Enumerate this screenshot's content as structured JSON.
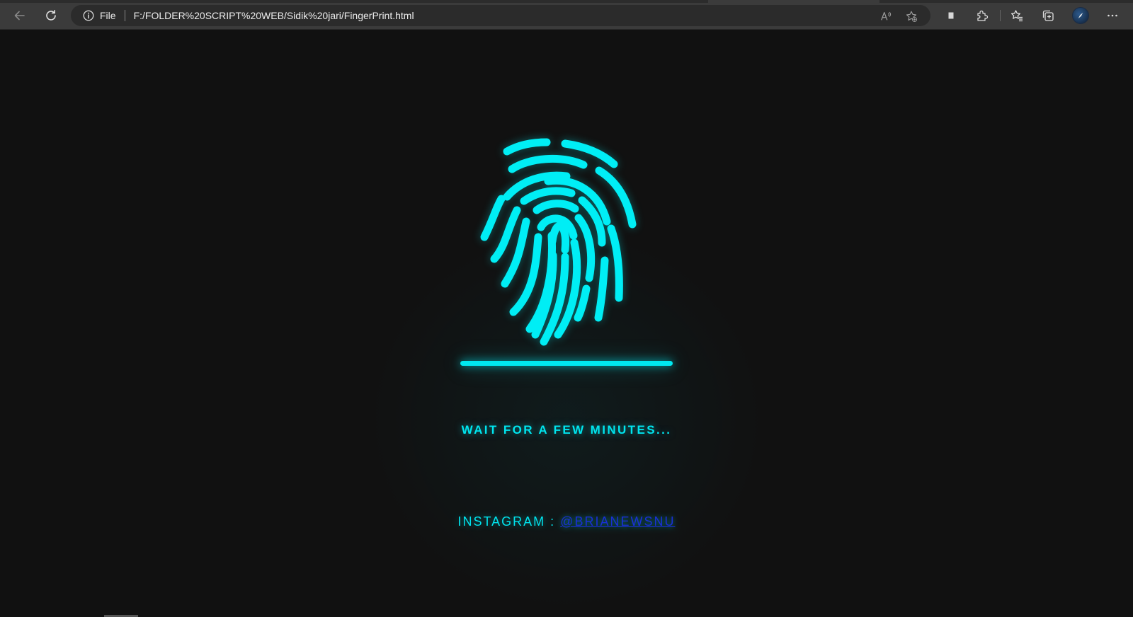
{
  "browser": {
    "site_info_label": "File",
    "url": "F:/FOLDER%20SCRIPT%20WEB/Sidik%20jari/FingerPrint.html",
    "icons": {
      "back": "back-arrow-icon",
      "reload": "reload-icon",
      "site_info": "info-icon",
      "read_aloud": "read-aloud-icon",
      "add_favorite": "add-favorite-icon",
      "stop": "stop-icon",
      "extensions": "extensions-icon",
      "favorites": "favorites-icon",
      "collections": "collections-icon",
      "profile": "profile-avatar",
      "menu": "more-menu-icon"
    }
  },
  "page": {
    "status_text": "WAIT FOR A FEW MINUTES...",
    "instagram_label": "INSTAGRAM : ",
    "instagram_handle": "@BRIANEWSNU",
    "accent_color": "#00e8f0",
    "background_color": "#111111"
  }
}
